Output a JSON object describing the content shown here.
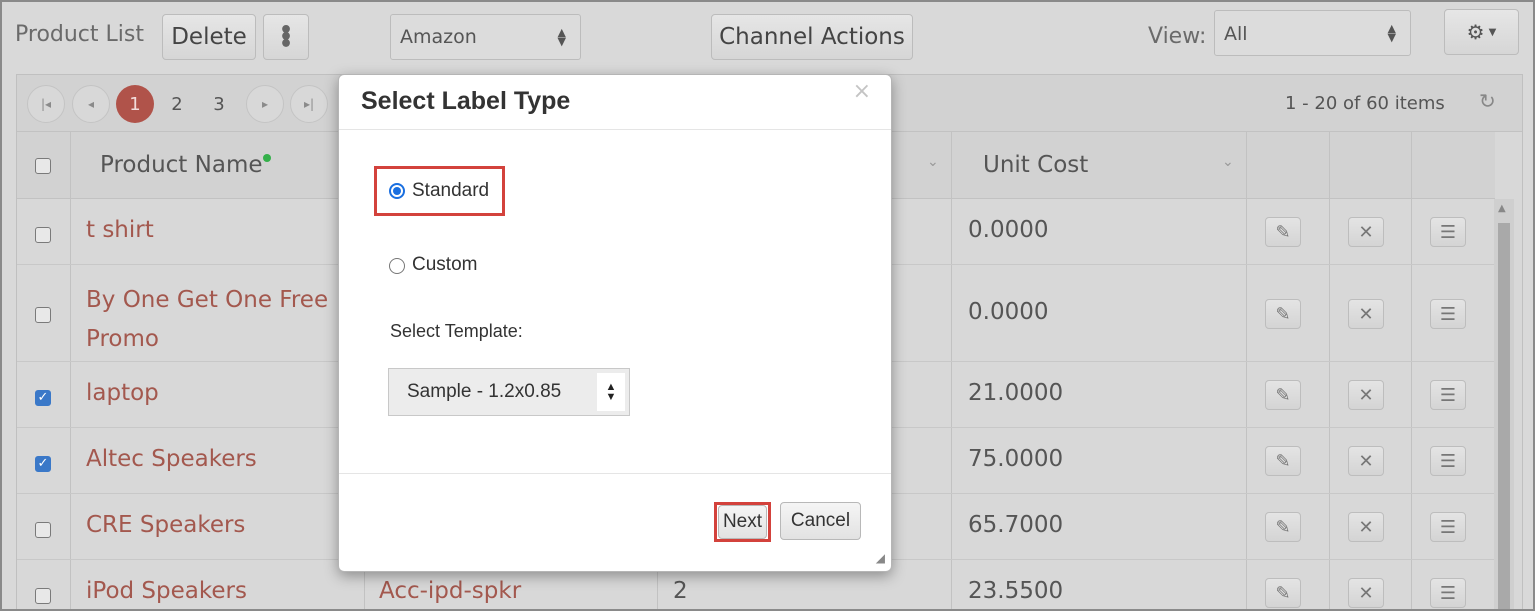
{
  "toolbar": {
    "title": "Product List",
    "delete_label": "Delete",
    "more_icon": "kebab-icon",
    "channel_select": "Amazon",
    "channel_actions_label": "Channel Actions",
    "view_label": "View:",
    "view_select": "All",
    "settings_icon": "gear-icon"
  },
  "pager": {
    "pages": [
      "1",
      "2",
      "3"
    ],
    "active_page": "1",
    "summary": "1 - 20 of 60 items"
  },
  "columns": {
    "product_name": "Product Name",
    "unit_cost": "Unit Cost"
  },
  "rows": [
    {
      "name": "t shirt",
      "name2": "",
      "sku": "",
      "qty": "",
      "cost": "0.0000",
      "checked": false
    },
    {
      "name": "By One Get One Free",
      "name2": "Promo",
      "sku": "",
      "qty": "",
      "cost": "0.0000",
      "checked": false
    },
    {
      "name": "laptop",
      "name2": "",
      "sku": "",
      "qty": "",
      "cost": "21.0000",
      "checked": true
    },
    {
      "name": "Altec Speakers",
      "name2": "",
      "sku": "",
      "qty": "",
      "cost": "75.0000",
      "checked": true
    },
    {
      "name": "CRE Speakers",
      "name2": "",
      "sku": "",
      "qty": "",
      "cost": "65.7000",
      "checked": false
    },
    {
      "name": "iPod Speakers",
      "name2": "",
      "sku": "Acc-ipd-spkr",
      "qty": "2",
      "cost": "23.5500",
      "checked": false
    }
  ],
  "modal": {
    "title": "Select Label Type",
    "close": "×",
    "option_standard": "Standard",
    "option_custom": "Custom",
    "selected": "Standard",
    "template_label": "Select Template:",
    "template_value": "Sample - 1.2x0.85",
    "next_label": "Next",
    "cancel_label": "Cancel"
  },
  "colors": {
    "highlight": "#d3423c",
    "link": "#a3584e",
    "active_page": "#b0534a",
    "radio_selected": "#1a6fe0"
  }
}
